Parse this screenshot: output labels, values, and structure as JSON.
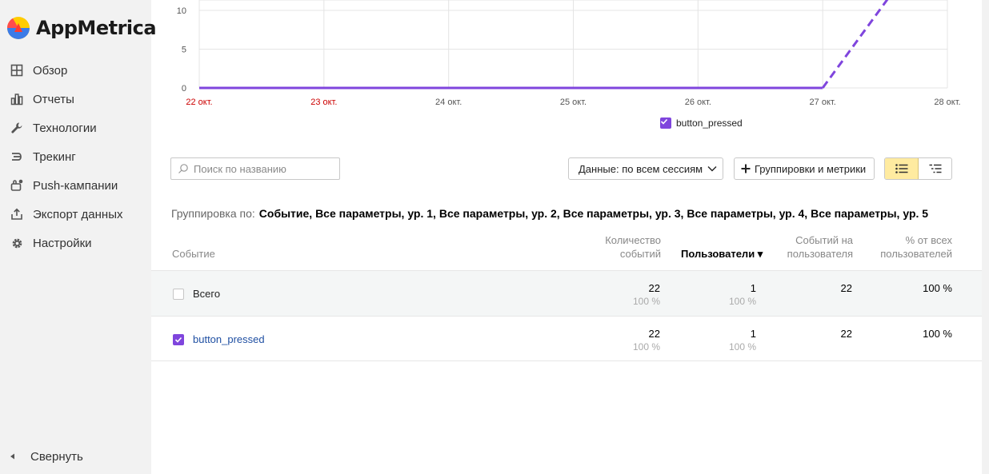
{
  "app": {
    "name": "AppMetrica"
  },
  "sidebar": {
    "items": [
      {
        "label": "Обзор",
        "icon": "grid-icon"
      },
      {
        "label": "Отчеты",
        "icon": "bar-chart-icon"
      },
      {
        "label": "Технологии",
        "icon": "wrench-icon"
      },
      {
        "label": "Трекинг",
        "icon": "tracking-icon"
      },
      {
        "label": "Push-кампании",
        "icon": "push-icon"
      },
      {
        "label": "Экспорт данных",
        "icon": "export-icon"
      },
      {
        "label": "Настройки",
        "icon": "gear-icon"
      }
    ],
    "collapse_label": "Свернуть"
  },
  "colors": {
    "accent": "#7f45dd",
    "weekend": "#cc0000",
    "active_toggle": "#ffeba0",
    "link": "#1f4fa2"
  },
  "chart_data": {
    "type": "line",
    "categories": [
      "22 окт.",
      "23 окт.",
      "24 окт.",
      "25 окт.",
      "26 окт.",
      "27 окт.",
      "28 окт."
    ],
    "weekend_categories": [
      "22 окт.",
      "23 окт."
    ],
    "y_ticks": [
      0,
      5,
      10
    ],
    "ylim": [
      0,
      12
    ],
    "grid": true,
    "series": [
      {
        "name": "button_pressed",
        "values": [
          0,
          0,
          0,
          0,
          0,
          0,
          22
        ],
        "dashed_last_segment": true,
        "color": "#7f45dd"
      }
    ],
    "legend": {
      "placement": "bottom-center",
      "label": "button_pressed",
      "checked": true
    }
  },
  "toolbar": {
    "search_placeholder": "Поиск по названию",
    "data_label": "Данные: по всем сессиям",
    "group_label": "Группировки и метрики"
  },
  "grouping": {
    "label": "Группировка по:",
    "value": "Событие, Все параметры, ур. 1, Все параметры, ур. 2, Все параметры, ур. 3, Все параметры, ур. 4, Все параметры, ур. 5"
  },
  "table": {
    "headers": {
      "event": "Событие",
      "count_line1": "Количество",
      "count_line2": "событий",
      "users": "Пользователи ▾",
      "per_user_line1": "Событий на",
      "per_user_line2": "пользователя",
      "pct_line1": "% от всех",
      "pct_line2": "пользователей"
    },
    "rows": [
      {
        "name": "Всего",
        "checked": false,
        "count": "22",
        "count_pct": "100 %",
        "users": "1",
        "users_pct": "100 %",
        "per_user": "22",
        "pct": "100 %"
      },
      {
        "name": "button_pressed",
        "checked": true,
        "count": "22",
        "count_pct": "100 %",
        "users": "1",
        "users_pct": "100 %",
        "per_user": "22",
        "pct": "100 %"
      }
    ]
  }
}
